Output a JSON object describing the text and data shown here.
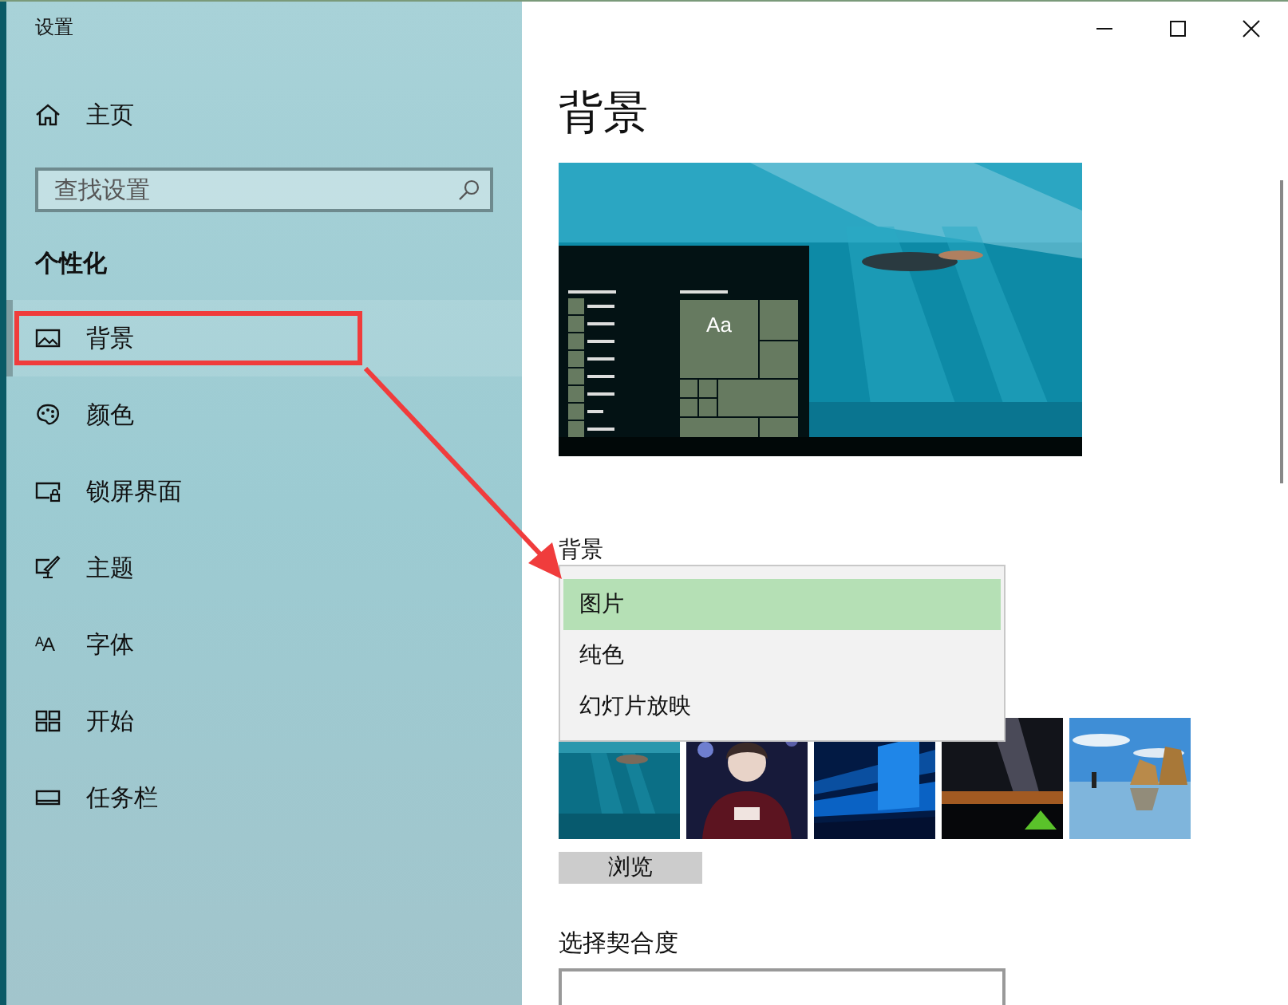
{
  "window": {
    "title": "设置"
  },
  "sidebar": {
    "home": "主页",
    "search": {
      "placeholder": "查找设置"
    },
    "section": "个性化",
    "items": [
      {
        "label": "背景",
        "selected": true
      },
      {
        "label": "颜色",
        "selected": false
      },
      {
        "label": "锁屏界面",
        "selected": false
      },
      {
        "label": "主题",
        "selected": false
      },
      {
        "label": "字体",
        "selected": false,
        "glyph": "ᴬA"
      },
      {
        "label": "开始",
        "selected": false
      },
      {
        "label": "任务栏",
        "selected": false
      }
    ]
  },
  "page": {
    "title": "背景",
    "preview": {
      "sample_text": "Aa"
    },
    "background_label": "背景",
    "dropdown": {
      "options": [
        {
          "label": "图片",
          "selected": true
        },
        {
          "label": "纯色",
          "selected": false
        },
        {
          "label": "幻灯片放映",
          "selected": false
        }
      ]
    },
    "browse_button": "浏览",
    "fit_label": "选择契合度"
  }
}
